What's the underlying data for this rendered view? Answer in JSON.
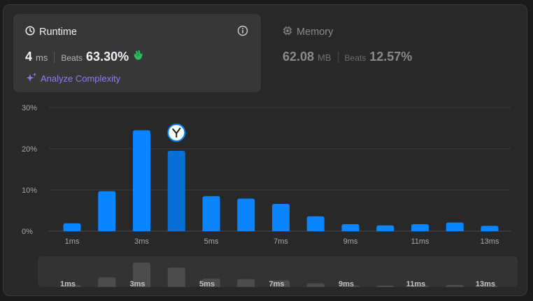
{
  "runtime": {
    "title": "Runtime",
    "value": "4",
    "unit": "ms",
    "beats_label": "Beats",
    "beats_value": "63.30%",
    "analyze_label": "Analyze Complexity"
  },
  "memory": {
    "title": "Memory",
    "value": "62.08",
    "unit": "MB",
    "beats_label": "Beats",
    "beats_value": "12.57%"
  },
  "colors": {
    "accent_bar": "#0a84ff",
    "selected_bar": "#0a6fd6",
    "analyze_purple": "#8e7cf2",
    "clap_green": "#2cbb5d"
  },
  "icons": {
    "runtime": "clock-icon",
    "memory": "chip-icon",
    "info": "info-icon",
    "analyze": "sparkle-icon",
    "clap": "clapping-hands-icon",
    "marker": "user-avatar-icon"
  },
  "chart_data": {
    "type": "bar",
    "y_ticks": [
      "30%",
      "20%",
      "10%",
      "0%"
    ],
    "ylim": [
      0,
      30
    ],
    "grid": true,
    "categories": [
      "1ms",
      "2ms",
      "3ms",
      "4ms",
      "5ms",
      "6ms",
      "7ms",
      "8ms",
      "9ms",
      "10ms",
      "11ms",
      "12ms",
      "13ms"
    ],
    "x_tick_labels": [
      "1ms",
      "",
      "3ms",
      "",
      "5ms",
      "",
      "7ms",
      "",
      "9ms",
      "",
      "11ms",
      "",
      "13ms"
    ],
    "values": [
      1.9,
      9.7,
      24.5,
      19.5,
      8.5,
      7.9,
      6.6,
      3.6,
      1.7,
      1.4,
      1.7,
      2.1,
      1.3
    ],
    "selected_index": 3,
    "navigator_tick_labels": [
      "1ms",
      "3ms",
      "5ms",
      "7ms",
      "9ms",
      "11ms",
      "13ms"
    ]
  }
}
